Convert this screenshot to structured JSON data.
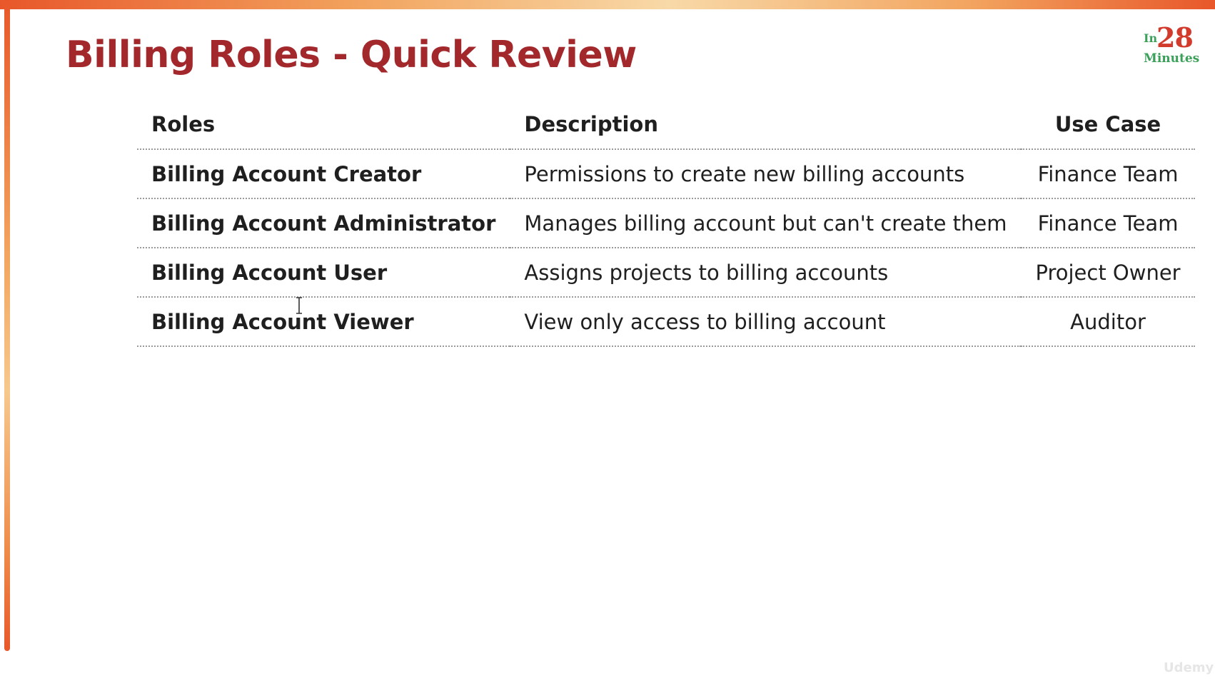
{
  "slide": {
    "title": "Billing Roles - Quick Review",
    "logo": {
      "prefix": "In",
      "number": "28",
      "suffix": "Minutes"
    },
    "watermark": "Udemy"
  },
  "table": {
    "headers": {
      "roles": "Roles",
      "description": "Description",
      "use_case": "Use Case"
    },
    "rows": [
      {
        "role": "Billing Account Creator",
        "description": "Permissions to create new billing accounts",
        "use_case": "Finance Team"
      },
      {
        "role": "Billing Account Administrator",
        "description": "Manages billing account but can't create them",
        "use_case": "Finance Team"
      },
      {
        "role": "Billing Account User",
        "description": "Assigns projects to billing accounts",
        "use_case": "Project Owner"
      },
      {
        "role": "Billing Account Viewer",
        "description": "View only access to billing account",
        "use_case": "Auditor"
      }
    ]
  },
  "colors": {
    "title": "#a2282c",
    "accent_orange": "#e8572a",
    "logo_red": "#d23b2c",
    "logo_green": "#3aa05a"
  },
  "icons": {
    "cursor": "text-cursor-icon"
  }
}
